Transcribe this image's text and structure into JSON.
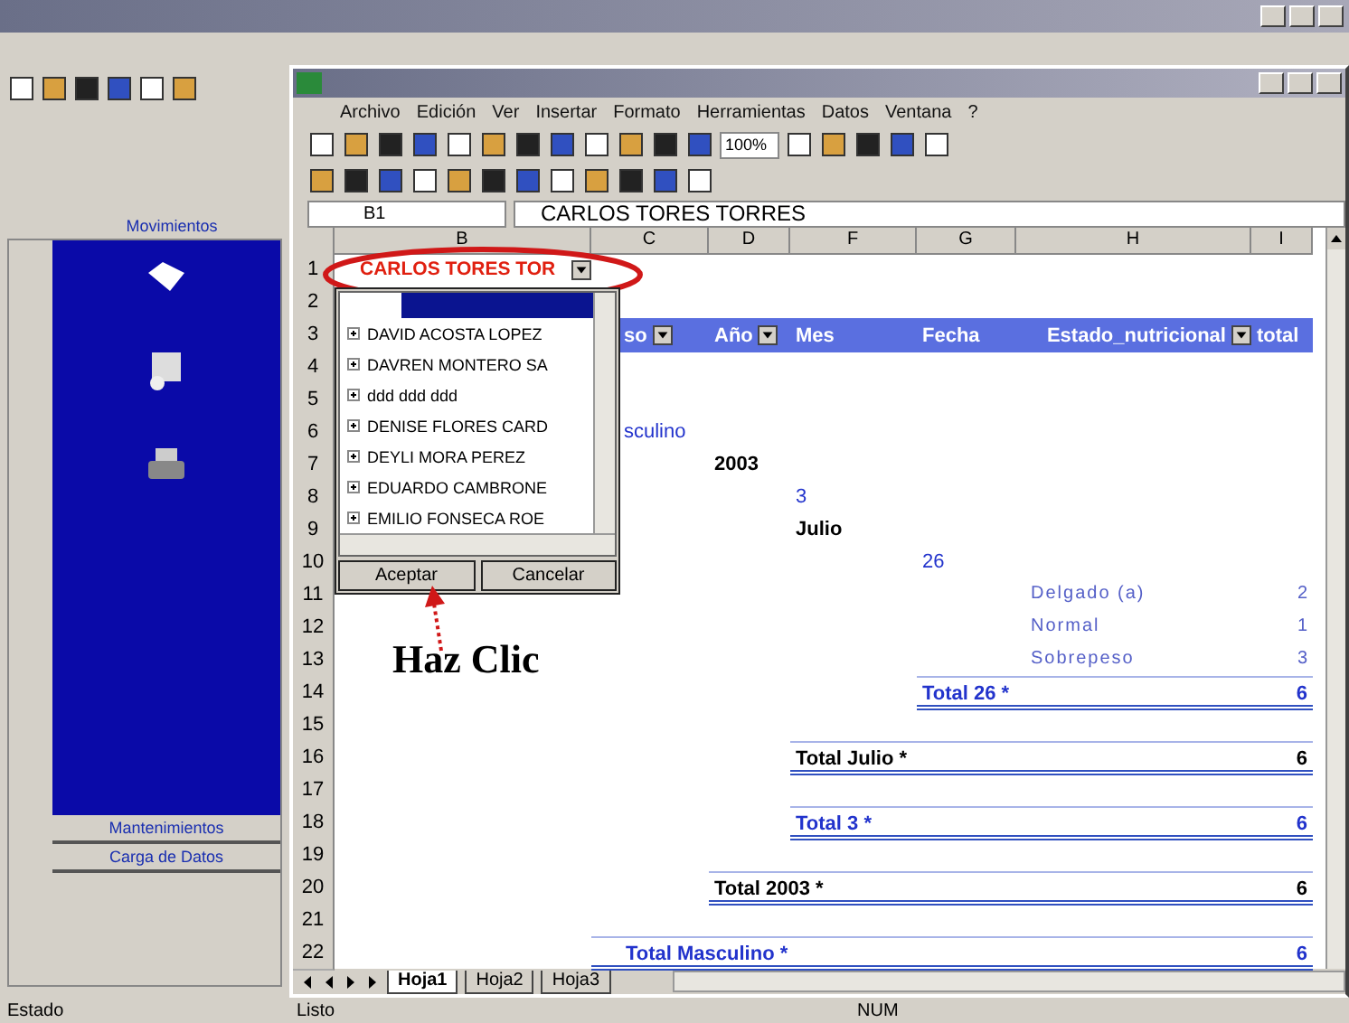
{
  "sidebar": {
    "header": "Movimientos",
    "footer": [
      "Mantenimientos",
      "Carga de Datos"
    ],
    "status": "Estado"
  },
  "excel": {
    "menu": [
      "Archivo",
      "Edición",
      "Ver",
      "Insertar",
      "Formato",
      "Herramientas",
      "Datos",
      "Ventana",
      "?"
    ],
    "zoom": "100%",
    "name_box": "B1",
    "formula": "CARLOS TORES TORRES",
    "columns": [
      "B",
      "C",
      "D",
      "F",
      "G",
      "H",
      "I"
    ],
    "rows": [
      {
        "number": "1",
        "kind": "plain",
        "cells": [
          {
            "text": "CARLOS TORES TOR",
            "kind": "field"
          }
        ]
      },
      {
        "number": "2",
        "kind": "plain",
        "cells": []
      },
      {
        "number": "3",
        "kind": "header",
        "cells": [
          "",
          {
            "text": "so",
            "kind": "head",
            "dropdown": true
          },
          {
            "text": "Año",
            "kind": "head",
            "dropdown": true
          },
          {
            "text": "Mes",
            "kind": "head",
            "dropdown": false
          },
          {
            "text": "Fecha",
            "kind": "head",
            "dropdown": false
          },
          {
            "text": "Estado_nutricional",
            "kind": "head",
            "dropdown": true
          },
          {
            "text": "total",
            "kind": "head",
            "dropdown": false
          }
        ]
      },
      {
        "number": "4",
        "kind": "plain",
        "cells": []
      },
      {
        "number": "5",
        "kind": "plain",
        "cells": []
      },
      {
        "number": "6",
        "kind": "plain",
        "cells": [
          "",
          {
            "text": "sculino",
            "kind": "item"
          }
        ]
      },
      {
        "number": "7",
        "kind": "plain",
        "cells": [
          "",
          "",
          {
            "text": "2003",
            "kind": "item_bold"
          }
        ]
      },
      {
        "number": "8",
        "kind": "plain",
        "cells": [
          "",
          "",
          "",
          {
            "text": "3",
            "kind": "item"
          }
        ]
      },
      {
        "number": "9",
        "kind": "plain",
        "cells": [
          "",
          "",
          "",
          {
            "text": "Julio",
            "kind": "item_bold"
          }
        ]
      },
      {
        "number": "10",
        "kind": "plain",
        "cells": [
          "",
          "",
          "",
          "",
          {
            "text": "26",
            "kind": "item"
          }
        ]
      },
      {
        "number": "11",
        "kind": "plain",
        "cells": [
          "",
          "",
          "",
          "",
          "",
          {
            "text": "Delgado (a)",
            "kind": "label"
          },
          {
            "text": "2",
            "kind": "value"
          }
        ]
      },
      {
        "number": "12",
        "kind": "plain",
        "cells": [
          "",
          "",
          "",
          "",
          "",
          {
            "text": "Normal",
            "kind": "label"
          },
          {
            "text": "1",
            "kind": "value"
          }
        ]
      },
      {
        "number": "13",
        "kind": "plain",
        "cells": [
          "",
          "",
          "",
          "",
          "",
          {
            "text": "Sobrepeso",
            "kind": "label"
          },
          {
            "text": "3",
            "kind": "value"
          }
        ]
      },
      {
        "number": "14",
        "kind": "total",
        "bold": false,
        "cells": [
          "",
          "",
          "",
          "",
          {
            "text": "Total 26 *",
            "kind": "total"
          },
          "",
          {
            "text": "6",
            "kind": "total"
          }
        ]
      },
      {
        "number": "15",
        "kind": "plain",
        "cells": []
      },
      {
        "number": "16",
        "kind": "total",
        "bold": true,
        "cells": [
          "",
          "",
          "",
          {
            "text": "Total Julio *",
            "kind": "total"
          },
          "",
          "",
          {
            "text": "6",
            "kind": "total"
          }
        ]
      },
      {
        "number": "17",
        "kind": "plain",
        "cells": []
      },
      {
        "number": "18",
        "kind": "total",
        "bold": false,
        "cells": [
          "",
          "",
          "",
          {
            "text": "Total 3 *",
            "kind": "total"
          },
          "",
          "",
          {
            "text": "6",
            "kind": "total"
          }
        ]
      },
      {
        "number": "19",
        "kind": "plain",
        "cells": []
      },
      {
        "number": "20",
        "kind": "total",
        "bold": true,
        "cells": [
          "",
          "",
          {
            "text": "Total 2003 *",
            "kind": "total"
          },
          "",
          "",
          "",
          {
            "text": "6",
            "kind": "total"
          }
        ]
      },
      {
        "number": "21",
        "kind": "plain",
        "cells": []
      },
      {
        "number": "22",
        "kind": "total",
        "bold": false,
        "cells": [
          "",
          {
            "text": "Total Masculino *",
            "kind": "total"
          },
          "",
          "",
          "",
          "",
          {
            "text": "6",
            "kind": "total"
          }
        ]
      }
    ],
    "dropdown": {
      "items": [
        {
          "label": "DAVID ACOSTA LOPEZ",
          "expanded": false
        },
        {
          "label": "DAVREN MONTERO SA",
          "expanded": false
        },
        {
          "label": "ddd ddd ddd",
          "expanded": false
        },
        {
          "label": "DENISE FLORES CARD",
          "expanded": false
        },
        {
          "label": "DEYLI MORA PEREZ",
          "expanded": false
        },
        {
          "label": "EDUARDO CAMBRONE",
          "expanded": false
        },
        {
          "label": "EMILIO FONSECA ROE",
          "expanded": false
        }
      ],
      "buttons": [
        "Aceptar",
        "Cancelar"
      ]
    },
    "annotation": "Haz Clic",
    "sheets": [
      {
        "label": "Hoja1",
        "selected": true
      },
      {
        "label": "Hoja2",
        "selected": false
      },
      {
        "label": "Hoja3",
        "selected": false
      }
    ],
    "status": "Listo",
    "status_right": "NUM"
  }
}
